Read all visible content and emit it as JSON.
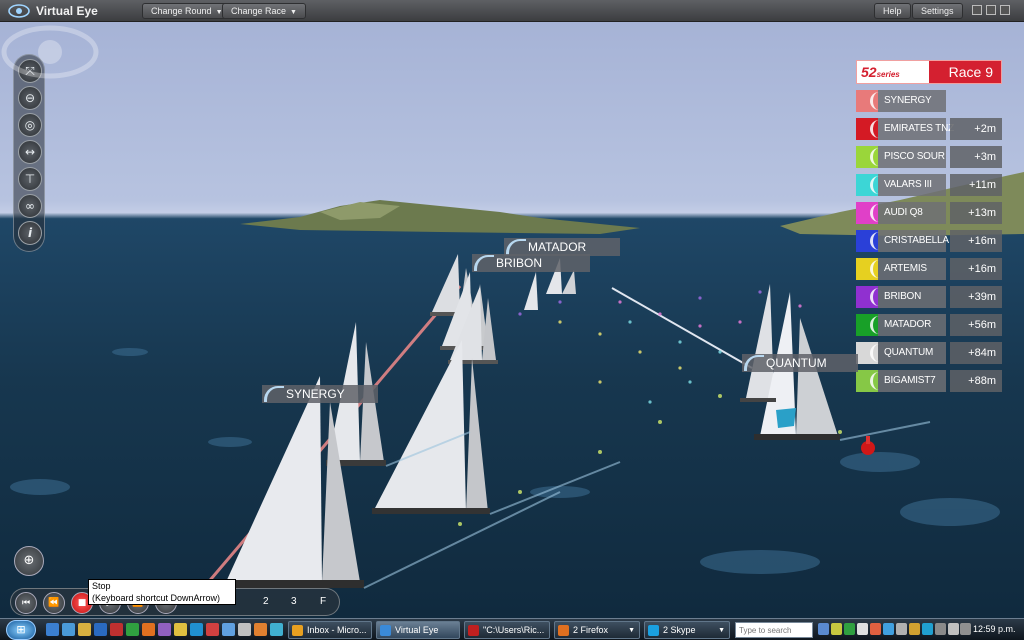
{
  "app": {
    "title": "Virtual Eye"
  },
  "menu": {
    "change_round": "Change Round",
    "change_race": "Change Race",
    "help": "Help",
    "settings": "Settings"
  },
  "left_toolbar": {
    "tools": [
      {
        "name": "camera-orbit-icon",
        "glyph": "⤧"
      },
      {
        "name": "camera-top-icon",
        "glyph": "⊖"
      },
      {
        "name": "binoculars-icon",
        "glyph": "◎"
      },
      {
        "name": "width-arrows-icon",
        "glyph": "↔"
      },
      {
        "name": "course-icon",
        "glyph": "⊤"
      },
      {
        "name": "follow-boats-icon",
        "glyph": "∞"
      },
      {
        "name": "info-icon",
        "glyph": "i"
      }
    ]
  },
  "leaderboard": {
    "series_label": "52",
    "series_sub": "series",
    "race_label": "Race 9",
    "rows": [
      {
        "team": "SYNERGY",
        "gap": "",
        "color": "#e87a7a"
      },
      {
        "team": "EMIRATES TNZ",
        "gap": "+2m",
        "color": "#d41a24"
      },
      {
        "team": "PISCO SOUR",
        "gap": "+3m",
        "color": "#9ad63a"
      },
      {
        "team": "VALARS III",
        "gap": "+11m",
        "color": "#3cd6d6"
      },
      {
        "team": "AUDI Q8",
        "gap": "+13m",
        "color": "#e040c8"
      },
      {
        "team": "CRISTABELLA",
        "gap": "+16m",
        "color": "#2a40d8"
      },
      {
        "team": "ARTEMIS",
        "gap": "+16m",
        "color": "#e6d020"
      },
      {
        "team": "BRIBON",
        "gap": "+39m",
        "color": "#9030d0"
      },
      {
        "team": "MATADOR",
        "gap": "+56m",
        "color": "#18a028"
      },
      {
        "team": "QUANTUM",
        "gap": "+84m",
        "color": "#d8d8d8"
      },
      {
        "team": "BIGAMIST7",
        "gap": "+88m",
        "color": "#86c846"
      }
    ]
  },
  "boat_labels": {
    "matador": "MATADOR",
    "bribon": "BRIBON",
    "synergy": "SYNERGY",
    "quantum": "QUANTUM"
  },
  "playback": {
    "speeds": [
      "2",
      "3",
      "F"
    ],
    "tooltip_title": "Stop",
    "tooltip_hint": "(Keyboard shortcut DownArrow)"
  },
  "taskbar": {
    "tasks": [
      {
        "label": "Inbox - Micro...",
        "icon_color": "#e8a020"
      },
      {
        "label": "Virtual Eye",
        "icon_color": "#3a8ad8"
      },
      {
        "label": "\"C:\\Users\\Ric...",
        "icon_color": "#c02020"
      },
      {
        "label": "2 Firefox",
        "icon_color": "#e07020"
      },
      {
        "label": "2 Skype",
        "icon_color": "#1aa0e0"
      }
    ],
    "search_placeholder": "Type to search",
    "clock": "12:59 p.m."
  }
}
